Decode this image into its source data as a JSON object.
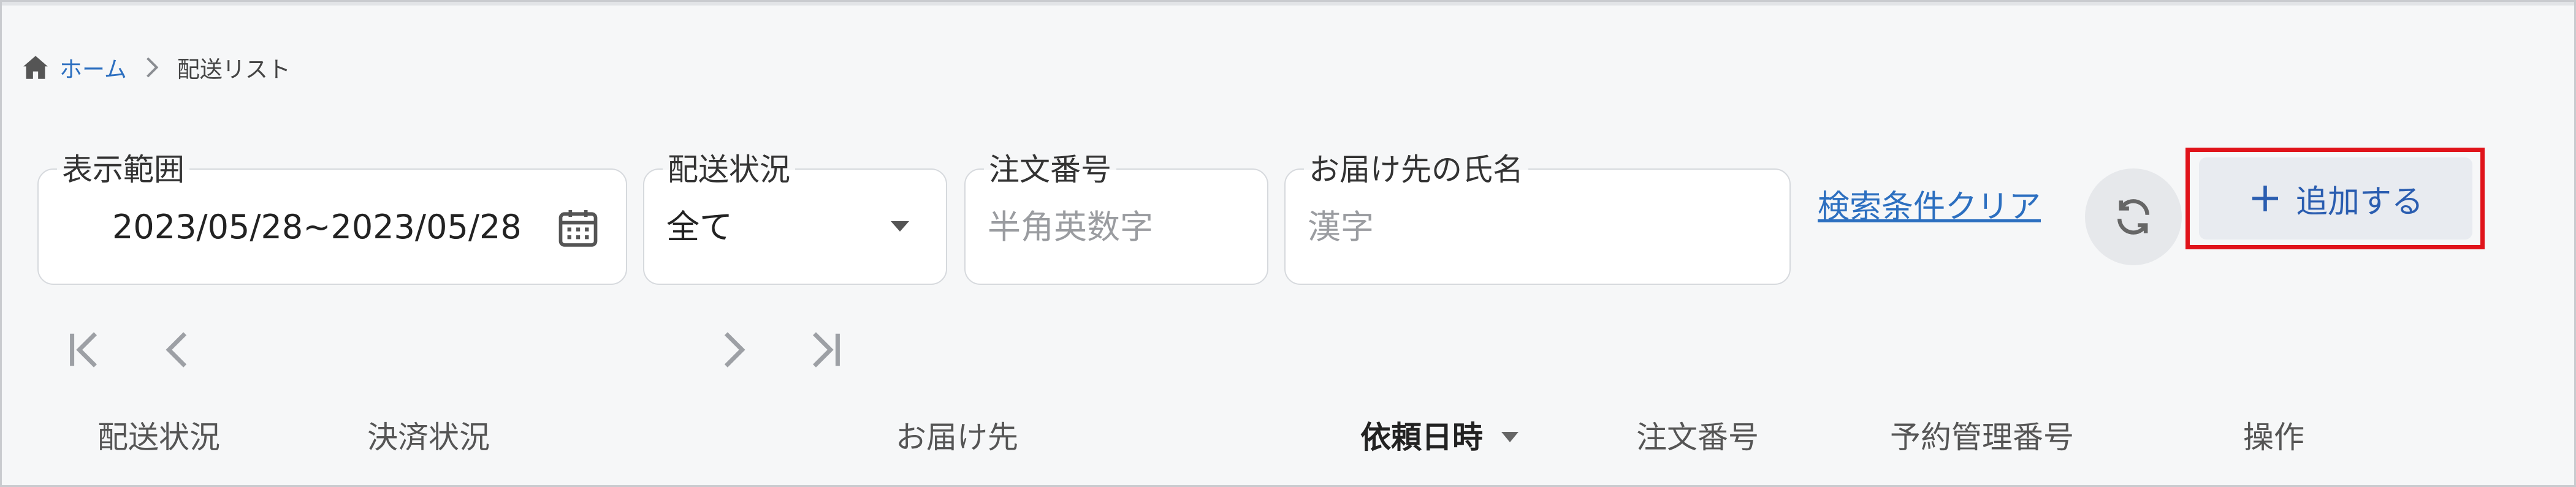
{
  "breadcrumb": {
    "home_label": "ホーム",
    "current_label": "配送リスト"
  },
  "filters": {
    "range": {
      "label": "表示範囲",
      "value": "2023/05/28~2023/05/28"
    },
    "status": {
      "label": "配送状況",
      "value": "全て"
    },
    "order_number": {
      "label": "注文番号",
      "placeholder": "半角英数字"
    },
    "recipient_name": {
      "label": "お届け先の氏名",
      "placeholder": "漢字"
    },
    "clear_label": "検索条件クリア"
  },
  "toolbar": {
    "add_label": "追加する"
  },
  "table": {
    "columns": [
      "配送状況",
      "決済状況",
      "お届け先",
      "依頼日時",
      "注文番号",
      "予約管理番号",
      "操作"
    ],
    "sorted_column": "依頼日時"
  },
  "icons": {
    "home": "home-icon",
    "separator": "chevron-right-icon",
    "calendar": "calendar-icon",
    "dropdown": "caret-down-icon",
    "refresh": "refresh-icon",
    "add": "plus-icon",
    "first": "first-page-icon",
    "prev": "prev-page-icon",
    "next": "next-page-icon",
    "last": "last-page-icon"
  },
  "colors": {
    "link": "#2c6fc0",
    "highlight": "#e0131a",
    "background": "#f6f7f8"
  }
}
